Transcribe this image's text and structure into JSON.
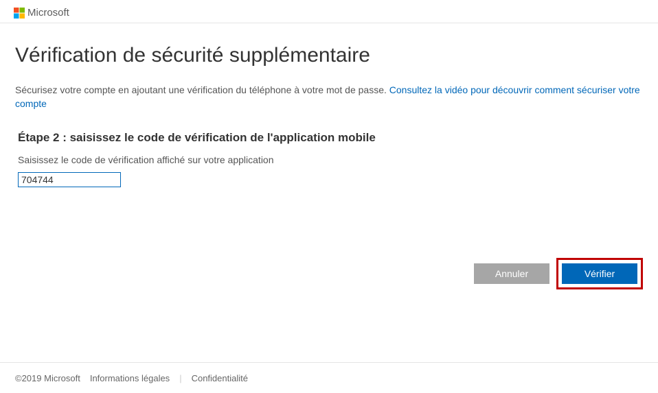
{
  "header": {
    "brand": "Microsoft"
  },
  "page": {
    "title": "Vérification de sécurité supplémentaire",
    "intro_text": "Sécurisez votre compte en ajoutant une vérification du téléphone à votre mot de passe. ",
    "intro_link": "Consultez la vidéo pour découvrir comment sécuriser votre compte"
  },
  "step": {
    "title": "Étape 2 : saisissez le code de vérification de l'application mobile",
    "instruction": "Saisissez le code de vérification affiché sur votre application",
    "code_value": "704744"
  },
  "actions": {
    "cancel": "Annuler",
    "verify": "Vérifier"
  },
  "footer": {
    "copyright": "©2019 Microsoft",
    "legal": "Informations légales",
    "privacy": "Confidentialité"
  }
}
